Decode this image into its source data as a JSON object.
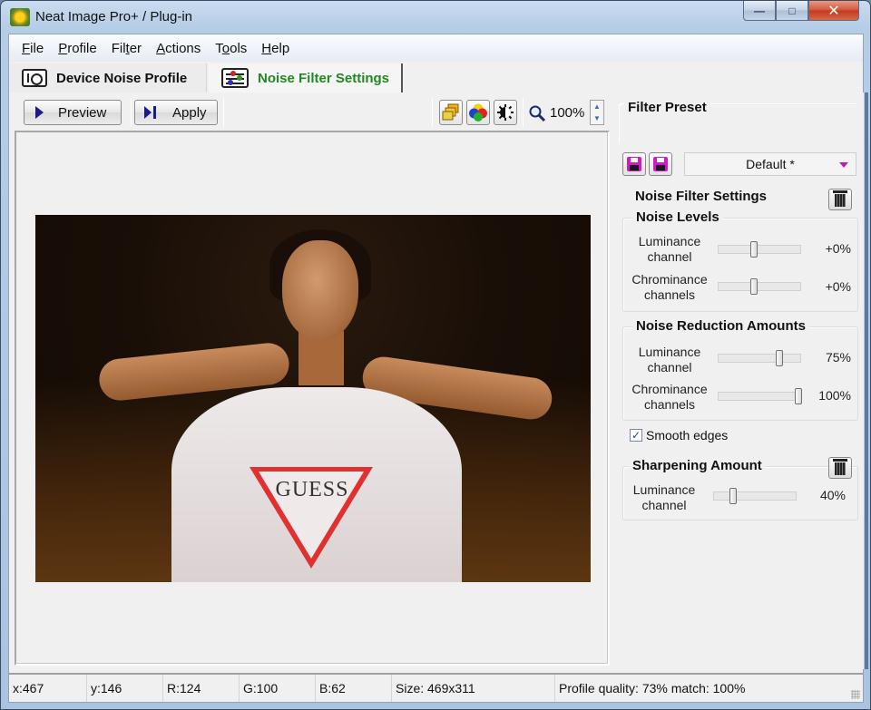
{
  "window": {
    "title": "Neat Image Pro+ / Plug-in",
    "controls": {
      "minimize": "—",
      "maximize": "□",
      "close": "✕"
    }
  },
  "menu": [
    {
      "label": "File",
      "accel": "F",
      "rest": "ile"
    },
    {
      "label": "Profile",
      "accel": "P",
      "rest": "rofile"
    },
    {
      "label": "Filter",
      "pre": "Fil",
      "accel": "t",
      "rest": "er"
    },
    {
      "label": "Actions",
      "accel": "A",
      "rest": "ctions"
    },
    {
      "label": "Tools",
      "pre": "T",
      "accel": "o",
      "rest": "ols"
    },
    {
      "label": "Help",
      "accel": "H",
      "rest": "elp"
    }
  ],
  "tabs": {
    "device": {
      "label": "Device Noise Profile",
      "icon": "camera-icon",
      "active": false
    },
    "filter": {
      "label": "Noise Filter Settings",
      "icon": "sliders-icon",
      "active": true,
      "color": "#1f8a1f"
    }
  },
  "toolbar": {
    "preview_label": "Preview",
    "apply_label": "Apply",
    "icons": [
      "layers-icon",
      "color-channels-icon",
      "brightness-icon",
      "magnifier-icon"
    ],
    "zoom_level": "100%"
  },
  "preview_image": {
    "description": "Photo of a woman in a wet white GUESS t-shirt against dark water",
    "logo_text": "GUESS"
  },
  "panel": {
    "filter_preset": {
      "title": "Filter Preset",
      "selected": "Default *",
      "buttons": [
        "load-preset-icon",
        "save-preset-icon"
      ]
    },
    "noise_filter_settings_title": "Noise Filter Settings",
    "noise_levels": {
      "title": "Noise Levels",
      "rows": [
        {
          "label_line1": "Luminance",
          "label_line2": "channel",
          "value": "+0%",
          "slider_fraction": 0.42
        },
        {
          "label_line1": "Chrominance",
          "label_line2": "channels",
          "value": "+0%",
          "slider_fraction": 0.42
        }
      ]
    },
    "noise_reduction": {
      "title": "Noise Reduction Amounts",
      "rows": [
        {
          "label_line1": "Luminance",
          "label_line2": "channel",
          "value": "75%",
          "slider_fraction": 0.75
        },
        {
          "label_line1": "Chrominance",
          "label_line2": "channels",
          "value": "100%",
          "slider_fraction": 1.0
        }
      ]
    },
    "smooth_edges": {
      "label": "Smooth edges",
      "checked": true
    },
    "sharpening": {
      "title": "Sharpening Amount",
      "rows": [
        {
          "label_line1": "Luminance",
          "label_line2": "channel",
          "value": "40%",
          "slider_fraction": 0.2
        }
      ]
    }
  },
  "status": {
    "x": "x:467",
    "y": "y:146",
    "r": "R:124",
    "g": "G:100",
    "b": "B:62",
    "size": "Size: 469x311",
    "profile": "Profile quality: 73%  match: 100%"
  }
}
